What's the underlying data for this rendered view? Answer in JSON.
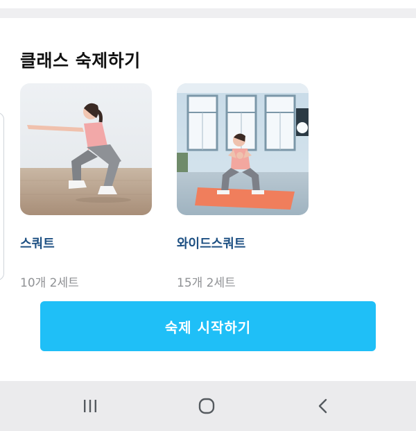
{
  "section": {
    "title": "클래스 숙제하기"
  },
  "exercises": [
    {
      "name": "스쿼트",
      "sets": "10개 2세트",
      "image": "squat-photo"
    },
    {
      "name": "와이드스쿼트",
      "sets": "15개 2세트",
      "image": "wide-squat-photo"
    }
  ],
  "start_button": {
    "label": "숙제 시작하기"
  },
  "nav_bar": {
    "recent_icon": "recent-apps-icon",
    "home_icon": "home-icon",
    "back_icon": "back-icon"
  },
  "colors": {
    "accent": "#1fbff7",
    "exercise_name": "#1c4f82",
    "sets_text": "#8f9194",
    "nav_bg": "#ebebed"
  }
}
